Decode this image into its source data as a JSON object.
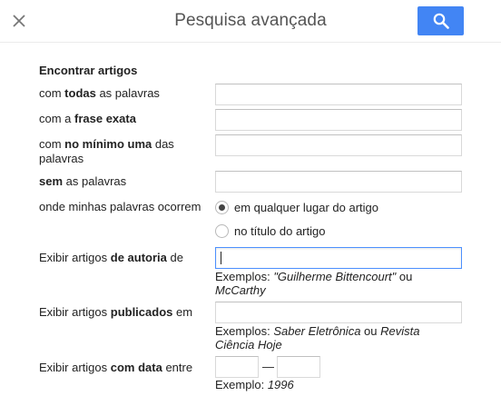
{
  "header": {
    "title": "Pesquisa avançada",
    "close_icon": "close-icon",
    "search_icon": "search-icon",
    "accent_color": "#4285f4"
  },
  "find": {
    "section_title": "Encontrar artigos",
    "all_words": {
      "pre": "com ",
      "bold": "todas",
      "post": " as palavras",
      "value": ""
    },
    "exact_phrase": {
      "pre": "com a ",
      "bold": "frase exata",
      "post": "",
      "value": ""
    },
    "at_least_one": {
      "pre": "com ",
      "bold": "no mínimo uma",
      "post": " das palavras",
      "value": ""
    },
    "without": {
      "pre": "",
      "bold": "sem",
      "post": " as palavras",
      "value": ""
    },
    "where_label": "onde minhas palavras ocorrem",
    "where_options": [
      {
        "label": "em qualquer lugar do artigo",
        "checked": true
      },
      {
        "label": "no título do artigo",
        "checked": false
      }
    ]
  },
  "author": {
    "pre": "Exibir artigos ",
    "bold": "de autoria",
    "post": " de",
    "value": "",
    "hint_prefix": "Exemplos: ",
    "hint_ex1": "\"Guilherme Bittencourt\"",
    "hint_mid": " ou ",
    "hint_ex2": "McCarthy"
  },
  "published": {
    "pre": "Exibir artigos ",
    "bold": "publicados",
    "post": " em",
    "value": "",
    "hint_prefix": "Exemplos: ",
    "hint_ex1": "Saber Eletrônica",
    "hint_mid": " ou ",
    "hint_ex2": "Revista Ciência Hoje"
  },
  "dated": {
    "pre": "Exibir artigos ",
    "bold": "com data",
    "post": " entre",
    "from_value": "",
    "to_value": "",
    "separator": "—",
    "hint_prefix": "Exemplo: ",
    "hint_ex": "1996"
  }
}
